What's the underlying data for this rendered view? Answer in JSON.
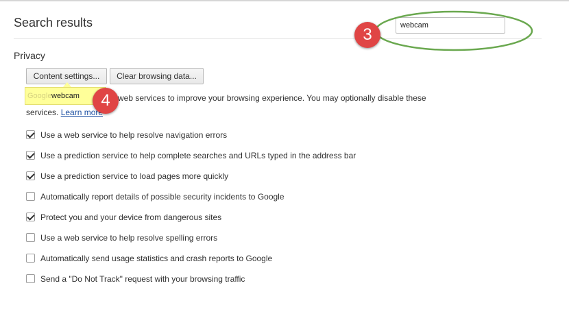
{
  "page": {
    "title": "Search results"
  },
  "search": {
    "value": "webcam"
  },
  "annotations": {
    "step3": "3",
    "step4": "4",
    "ellipse_color": "#6aa84f",
    "badge_color": "#e04545"
  },
  "privacy": {
    "heading": "Privacy",
    "content_settings_label": "Content settings...",
    "clear_browsing_label": "Clear browsing data...",
    "description_prefix": "Google",
    "description_text": "web services to improve your browsing experience. You may optionally disable these",
    "description_line2": "services.",
    "learn_more": "Learn more",
    "highlight_bubble": "webcam",
    "options": [
      {
        "label": "Use a web service to help resolve navigation errors",
        "checked": true
      },
      {
        "label": "Use a prediction service to help complete searches and URLs typed in the address bar",
        "checked": true
      },
      {
        "label": "Use a prediction service to load pages more quickly",
        "checked": true
      },
      {
        "label": "Automatically report details of possible security incidents to Google",
        "checked": false
      },
      {
        "label": "Protect you and your device from dangerous sites",
        "checked": true
      },
      {
        "label": "Use a web service to help resolve spelling errors",
        "checked": false
      },
      {
        "label": "Automatically send usage statistics and crash reports to Google",
        "checked": false
      },
      {
        "label": "Send a \"Do Not Track\" request with your browsing traffic",
        "checked": false
      }
    ]
  }
}
